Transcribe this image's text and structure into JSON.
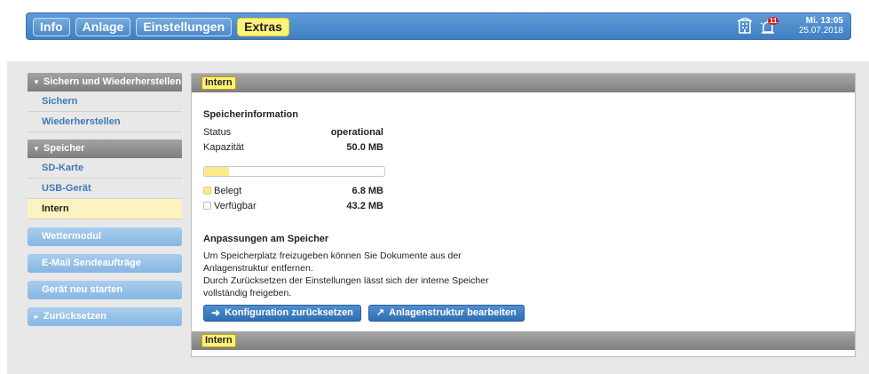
{
  "topbar": {
    "tabs": [
      {
        "label": "Info"
      },
      {
        "label": "Anlage"
      },
      {
        "label": "Einstellungen"
      },
      {
        "label": "Extras"
      }
    ],
    "notification_count": "11",
    "clock": {
      "time": "Mi. 13:05",
      "date": "25.07.2018"
    }
  },
  "sidebar": {
    "sections": [
      {
        "title": "Sichern und Wiederherstellen",
        "items": [
          "Sichern",
          "Wiederherstellen"
        ]
      },
      {
        "title": "Speicher",
        "items": [
          "SD-Karte",
          "USB-Gerät",
          "Intern"
        ]
      }
    ],
    "buttons": [
      "Wettermodul",
      "E-Mail Sendeaufträge",
      "Gerät neu starten",
      "Zurücksetzen"
    ]
  },
  "panel": {
    "header_label": "Intern",
    "footer_label": "Intern",
    "info_title": "Speicherinformation",
    "status_label": "Status",
    "status_value": "operational",
    "capacity_label": "Kapazität",
    "capacity_value": "50.0 MB",
    "used_fraction": 0.136,
    "used_label": "Belegt",
    "used_value": "6.8 MB",
    "free_label": "Verfügbar",
    "free_value": "43.2 MB",
    "adjust_title": "Anpassungen am Speicher",
    "desc_line1": "Um Speicherplatz freizugeben können Sie Dokumente aus der",
    "desc_line2": "Anlagenstruktur entfernen.",
    "desc_line3": "Durch Zurücksetzen der Einstellungen lässt sich der interne Speicher",
    "desc_line4": "vollständig freigeben.",
    "btn_reset": "Konfiguration zurücksetzen",
    "btn_edit": "Anlagenstruktur bearbeiten"
  },
  "colors": {
    "accent": "#4a8ac9",
    "highlight": "#fdf27a",
    "used": "#fbe98a"
  }
}
